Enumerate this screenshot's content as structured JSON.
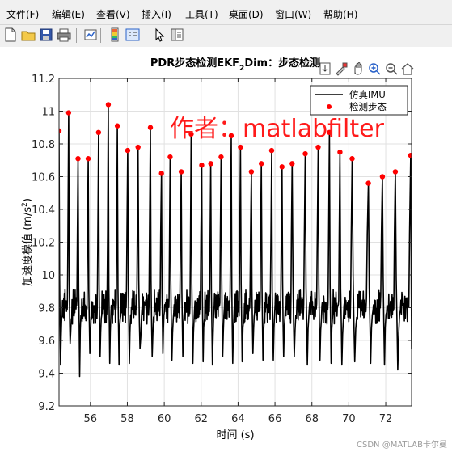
{
  "menu": [
    "文件(F)",
    "编辑(E)",
    "查看(V)",
    "插入(I)",
    "工具(T)",
    "桌面(D)",
    "窗口(W)",
    "帮助(H)"
  ],
  "toolbar_icons": [
    "new-figure-icon",
    "open-file-icon",
    "save-icon",
    "print-icon",
    "link-plot-icon",
    "insert-colorbar-icon",
    "insert-legend-icon",
    "edit-plot-icon",
    "property-inspector-icon"
  ],
  "axes_toolbar_icons": [
    "save-export-icon",
    "brush-icon",
    "pan-icon",
    "zoom-in-icon",
    "zoom-out-icon",
    "restore-view-icon"
  ],
  "watermark": "作者：matlabfilter",
  "credit": "CSDN @MATLAB卡尔曼",
  "colors": {
    "signal": "#000000",
    "steps": "#ff0000",
    "watermark": "#ff1a1a"
  },
  "chart_data": {
    "type": "line",
    "title_parts": [
      "PDR步态检测EKF",
      "2",
      "Dim：步态检测"
    ],
    "xlabel": "时间 (s)",
    "ylabel_parts": [
      "加速度模值 (m/s",
      "2",
      ")"
    ],
    "xlim": [
      54.3,
      73.4
    ],
    "ylim": [
      9.2,
      11.2
    ],
    "xticks": [
      56,
      58,
      60,
      62,
      64,
      66,
      68,
      70,
      72
    ],
    "xtick_labels": [
      "56",
      "58",
      "60",
      "62",
      "64",
      "66",
      "68",
      "70",
      "72"
    ],
    "yticks": [
      9.2,
      9.4,
      9.6,
      9.8,
      10,
      10.2,
      10.4,
      10.6,
      10.8,
      11,
      11.2
    ],
    "ytick_labels": [
      "9.2",
      "9.4",
      "9.6",
      "9.8",
      "10",
      "10.2",
      "10.4",
      "10.6",
      "10.8",
      "11",
      "11.2"
    ],
    "grid": true,
    "legend_position": "top-right",
    "series": [
      {
        "name": "仿真IMU",
        "style": "line",
        "color": "#000000",
        "peaks_from": "检测步态"
      },
      {
        "name": "检测步态",
        "style": "markers",
        "color": "#ff0000",
        "x": [
          54.3,
          54.82,
          55.33,
          55.88,
          56.44,
          56.97,
          57.46,
          58.02,
          58.58,
          59.25,
          59.85,
          60.32,
          60.92,
          61.46,
          62.03,
          62.52,
          63.08,
          63.63,
          64.13,
          64.72,
          65.26,
          65.82,
          66.38,
          66.93,
          67.64,
          68.34,
          68.95,
          69.52,
          70.18,
          71.06,
          71.82,
          72.52,
          73.35
        ],
        "y": [
          10.88,
          10.99,
          10.71,
          10.71,
          10.87,
          11.04,
          10.91,
          10.76,
          10.78,
          10.9,
          10.62,
          10.72,
          10.63,
          10.86,
          10.67,
          10.68,
          10.72,
          10.85,
          10.78,
          10.63,
          10.68,
          10.76,
          10.66,
          10.68,
          10.74,
          10.78,
          10.87,
          10.75,
          10.71,
          10.56,
          10.6,
          10.63,
          10.73
        ]
      }
    ]
  }
}
